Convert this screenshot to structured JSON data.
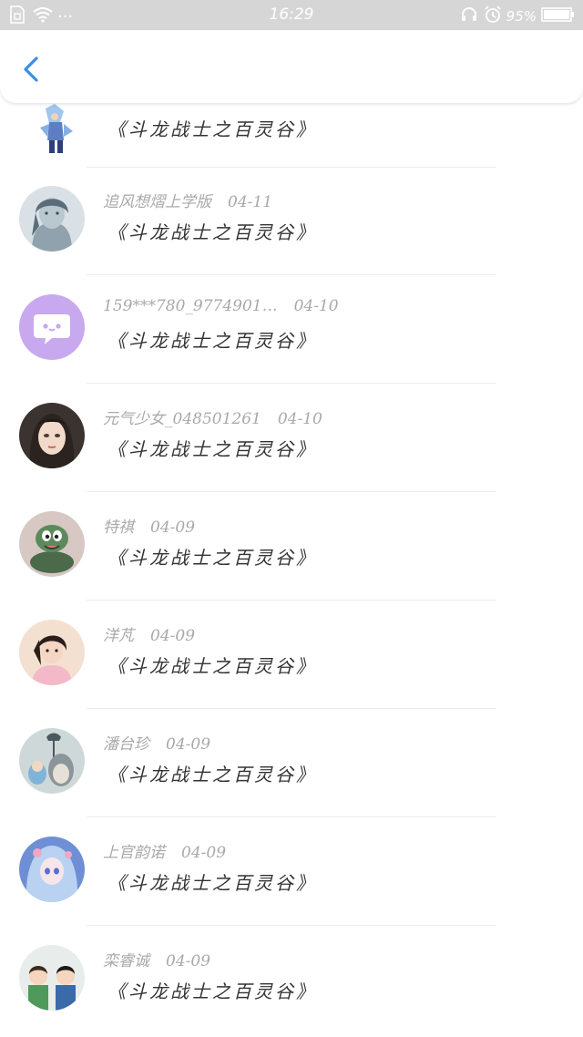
{
  "status_bar": {
    "time": "16:29",
    "battery": "95%",
    "dots": "···"
  },
  "list": {
    "items": [
      {
        "user": "",
        "date": "",
        "title": "《斗龙战士之百灵谷》",
        "avatar": "anime-warrior"
      },
      {
        "user": "追风想熠上学版",
        "date": "04-11",
        "title": "《斗龙战士之百灵谷》",
        "avatar": "sketch-girl"
      },
      {
        "user": "159***780_9774901…",
        "date": "04-10",
        "title": "《斗龙战士之百灵谷》",
        "avatar": "chat-bubble"
      },
      {
        "user": "元气少女_048501261",
        "date": "04-10",
        "title": "《斗龙战士之百灵谷》",
        "avatar": "girl-photo"
      },
      {
        "user": "特祺",
        "date": "04-09",
        "title": "《斗龙战士之百灵谷》",
        "avatar": "snake-cartoon"
      },
      {
        "user": "洋芃",
        "date": "04-09",
        "title": "《斗龙战士之百灵谷》",
        "avatar": "girl-pink"
      },
      {
        "user": "潘台珍",
        "date": "04-09",
        "title": "《斗龙战士之百灵谷》",
        "avatar": "totoro-toy"
      },
      {
        "user": "上官韵诺",
        "date": "04-09",
        "title": "《斗龙战士之百灵谷》",
        "avatar": "anime-blue-girl"
      },
      {
        "user": "栾睿诚",
        "date": "04-09",
        "title": "《斗龙战士之百灵谷》",
        "avatar": "two-kids"
      }
    ]
  },
  "colors": {
    "accent": "#3a8ee6",
    "status_bar_bg": "#d6d6d6",
    "meta_text": "#a9a9a9",
    "title_text": "#333333",
    "chat_bubble_bg": "#c8a8ee"
  },
  "icons": {
    "back": "chevron-left-icon",
    "headset": "headset-icon",
    "alarm": "alarm-icon",
    "battery": "battery-icon",
    "wifi": "wifi-icon",
    "sim": "sim-card-icon"
  }
}
